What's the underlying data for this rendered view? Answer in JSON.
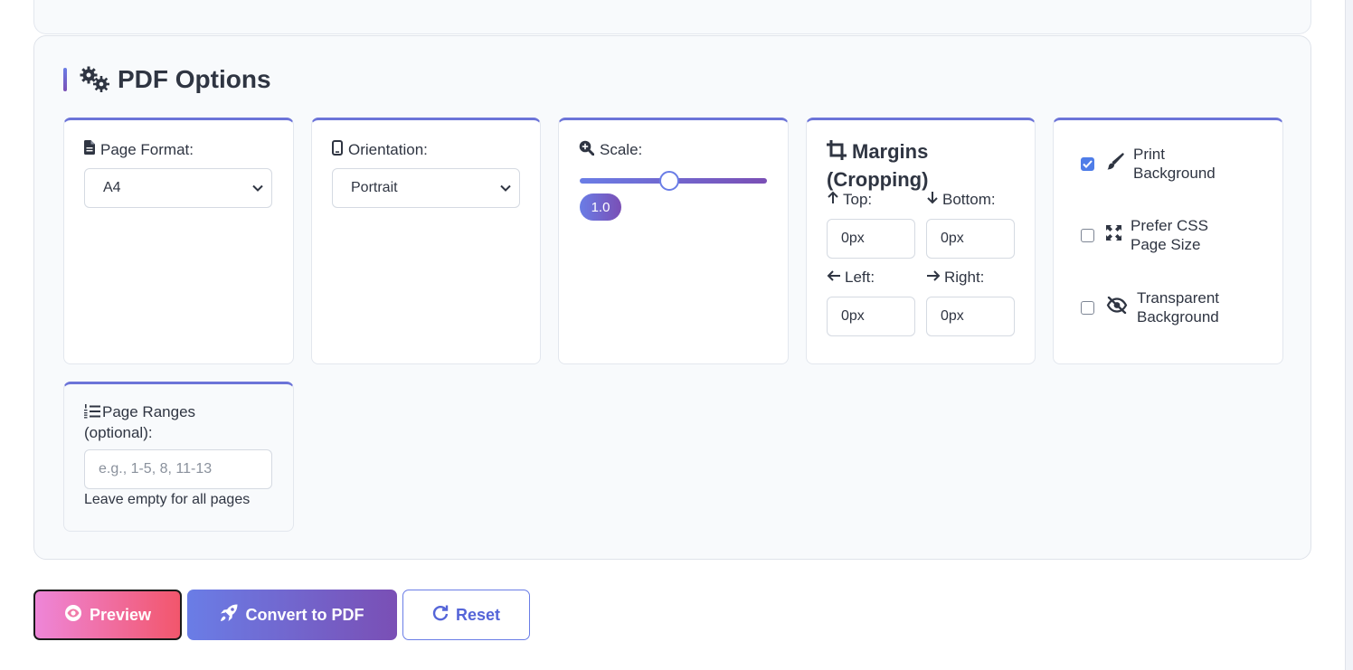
{
  "section": {
    "title": "PDF Options"
  },
  "page_format": {
    "label": "Page Format:",
    "value": "A4"
  },
  "orientation": {
    "label": "Orientation:",
    "value": "Portrait"
  },
  "scale": {
    "label": "Scale:",
    "value": "1.0",
    "fraction": 0.45
  },
  "margins": {
    "title": "Margins (Cropping)",
    "top_label": "Top:",
    "top_value": "0px",
    "bottom_label": "Bottom:",
    "bottom_value": "0px",
    "left_label": "Left:",
    "left_value": "0px",
    "right_label": "Right:",
    "right_value": "0px"
  },
  "options": {
    "print_background": {
      "label_line1": "Print",
      "label_line2": "Background",
      "checked": true
    },
    "prefer_css": {
      "label_line1": "Prefer CSS",
      "label_line2": "Page Size",
      "checked": false
    },
    "transparent": {
      "label_line1": "Transparent",
      "label_line2": "Background",
      "checked": false
    }
  },
  "page_ranges": {
    "label_line1": "Page Ranges",
    "label_line2": "(optional):",
    "placeholder": "e.g., 1-5, 8, 11-13",
    "hint": "Leave empty for all pages"
  },
  "buttons": {
    "preview": "Preview",
    "convert": "Convert to PDF",
    "reset": "Reset"
  },
  "colors": {
    "accent_start": "#6a7de6",
    "accent_end": "#7a4fb5",
    "preview_start": "#ee86d8",
    "preview_end": "#f2566c"
  }
}
